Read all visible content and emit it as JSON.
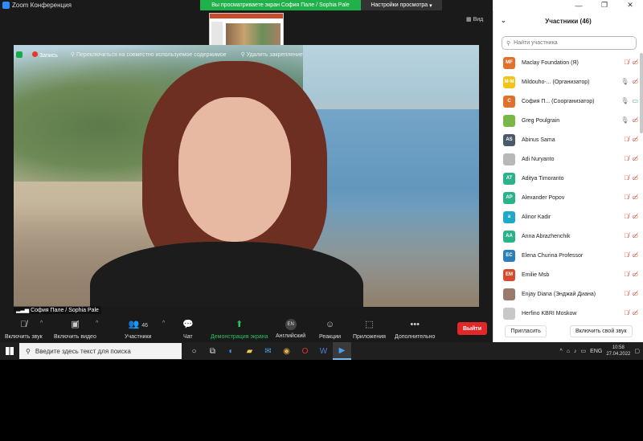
{
  "window": {
    "title": "Zoom Конференция",
    "share_banner": "Вы просматриваете экран София Пале / Sophia Pale",
    "view_options": "Настройки просмотра",
    "view_button": "Вид",
    "window_controls": [
      "—",
      "❐",
      "✕"
    ]
  },
  "video": {
    "toolbar": {
      "record": "Запись",
      "switch_shared": "Переключиться на совместно используемое содержимое",
      "unpin": "Удалить закрепление"
    },
    "speaker_name": "София Пале / Sophia Pale"
  },
  "controls": {
    "unmute": "Включить звук",
    "start_video": "Включить видео",
    "participants": "Участники",
    "participants_count": "46",
    "chat": "Чат",
    "share": "Демонстрация экрана",
    "language": "Английский",
    "language_badge": "EN",
    "reactions": "Реакции",
    "apps": "Приложения",
    "more": "Дополнительно",
    "leave": "Выйти"
  },
  "panel": {
    "title": "Участники (46)",
    "search_placeholder": "Найти участника",
    "invite": "Пригласить",
    "unmute_me": "Включить свой звук",
    "participants": [
      {
        "initials": "MF",
        "name": "Maclay Foundation (Я)",
        "color": "#e0712c",
        "mic": "off",
        "cam": "off"
      },
      {
        "initials": "M-M",
        "name": "Mildouho-... (Организатор)",
        "color": "#f0c419",
        "mic": "on",
        "cam": "off"
      },
      {
        "initials": "С",
        "name": "София П... (Соорганизатор)",
        "color": "#e0712c",
        "mic": "on",
        "cam": "on"
      },
      {
        "initials": "",
        "name": "Greg Poulgrain",
        "color": "#7ab648",
        "mic": "on",
        "cam": "off"
      },
      {
        "initials": "AS",
        "name": "Abinus Sama",
        "color": "#4a5a6a",
        "mic": "off",
        "cam": "off"
      },
      {
        "initials": "",
        "name": "Adi Nuryanto",
        "color": "#b8b8b8",
        "mic": "off",
        "cam": "off"
      },
      {
        "initials": "AT",
        "name": "Aditya Timoranto",
        "color": "#2bb28b",
        "mic": "off",
        "cam": "off"
      },
      {
        "initials": "AP",
        "name": "Alexander Popov",
        "color": "#2bb28b",
        "mic": "off",
        "cam": "off"
      },
      {
        "initials": "a",
        "name": "Alinor Kadir",
        "color": "#1fa8c9",
        "mic": "off",
        "cam": "off"
      },
      {
        "initials": "AA",
        "name": "Anna Abrazhenchik",
        "color": "#2bb28b",
        "mic": "off",
        "cam": "off"
      },
      {
        "initials": "EC",
        "name": "Elena Churina Professor",
        "color": "#2a7fb8",
        "mic": "off",
        "cam": "off"
      },
      {
        "initials": "EM",
        "name": "Emilie Msb",
        "color": "#d44b2f",
        "mic": "off",
        "cam": "off"
      },
      {
        "initials": "",
        "name": "Enjay Diana (Энджай Диана)",
        "color": "#9a7a6a",
        "mic": "off",
        "cam": "off"
      },
      {
        "initials": "",
        "name": "Herfino KBRI Moskow",
        "color": "#c8c8c8",
        "mic": "off",
        "cam": "off"
      }
    ]
  },
  "taskbar": {
    "search_placeholder": "Введите здесь текст для поиска",
    "language": "ENG",
    "time": "10:58",
    "date": "27.04.2022"
  }
}
